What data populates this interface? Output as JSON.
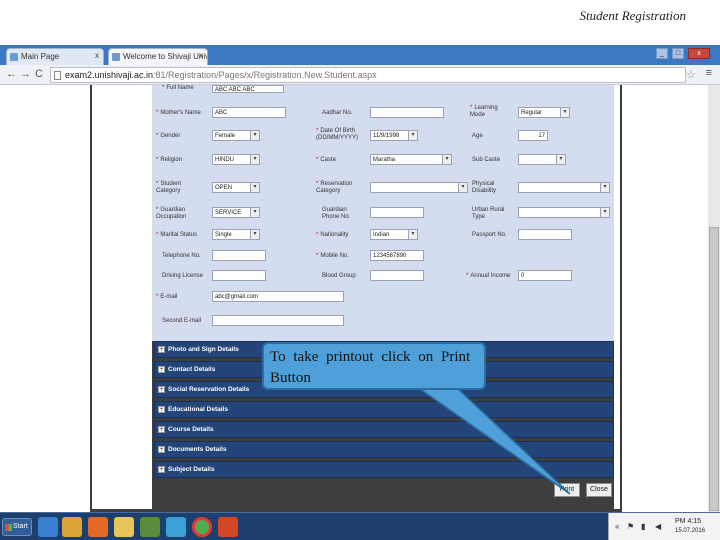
{
  "slide_title": "Student Registration",
  "browser": {
    "tabs": [
      {
        "label": "Main Page",
        "close": "x",
        "active": false
      },
      {
        "label": "Welcome to Shivaji Univer",
        "close": "x",
        "active": true
      }
    ],
    "window_controls": {
      "minimize": "_",
      "maximize": "□",
      "close": "x"
    },
    "url_host": "exam2.unishivaji.ac.in",
    "url_rest": ":81/Registration/Pages/x/Registration.New.Student.aspx",
    "nav": {
      "back": "←",
      "forward": "→",
      "reload": "C"
    },
    "star": "☆",
    "menu": "≡"
  },
  "form": {
    "full_name": {
      "value": "ABC ABC ABC"
    },
    "mothers_name": {
      "label": "Mother's Name",
      "value": "ABC"
    },
    "aadhar": {
      "label": "Aadhar No.",
      "value": ""
    },
    "learning_mode": {
      "label": "Learning Mode",
      "value": "Regular"
    },
    "gender": {
      "label": "Gender",
      "value": "Female"
    },
    "dob": {
      "label": "Date Of Birth (DD/MM/YYYY)",
      "value": "11/9/1998"
    },
    "age": {
      "label": "Age",
      "value": "17"
    },
    "religion": {
      "label": "Religion",
      "value": "HINDU"
    },
    "caste": {
      "label": "Caste",
      "value": "Maratha"
    },
    "sub_caste": {
      "label": "Sub Caste",
      "value": ""
    },
    "student_category": {
      "label": "Student Category",
      "value": "OPEN"
    },
    "reservation_category": {
      "label": "Reservation Category",
      "value": ""
    },
    "physical_disability": {
      "label": "Physical Disability",
      "value": ""
    },
    "guardian_occupation": {
      "label": "Guardian Occupation",
      "value": "SERVICE"
    },
    "guardian_phone": {
      "label": "Guardian Phone No.",
      "value": ""
    },
    "urban_rural": {
      "label": "Urban Rural Type",
      "value": ""
    },
    "marital_status": {
      "label": "Marital Status",
      "value": "Single"
    },
    "nationality": {
      "label": "Nationality",
      "value": "Indian"
    },
    "passport": {
      "label": "Passport No.",
      "value": ""
    },
    "telephone": {
      "label": "Telephone No.",
      "value": ""
    },
    "mobile": {
      "label": "Mobile No.",
      "value": "1234567890"
    },
    "driving_license": {
      "label": "Driving License",
      "value": ""
    },
    "blood_group": {
      "label": "Blood Group",
      "value": ""
    },
    "annual_income": {
      "label": "Annual Income",
      "value": "0"
    },
    "email": {
      "label": "E-mail",
      "value": "abc@gmail.com"
    },
    "second_email": {
      "label": "Second E-mail",
      "value": ""
    }
  },
  "sections": [
    "Photo and Sign Details",
    "Contact Details",
    "Social Reservation Details",
    "Educational Details",
    "Course Details",
    "Documents Details",
    "Subject Details"
  ],
  "buttons": {
    "print": "Print",
    "close": "Close"
  },
  "callout": "To take printout click on Print Button",
  "taskbar": {
    "start": "Start",
    "time": "PM 4:15",
    "date": "15.07.2016"
  },
  "colors": {
    "accent": "#24457a",
    "form_bg": "#d4dcef",
    "callout": "#4fa0d8",
    "taskbar": "#1d3f6e"
  }
}
